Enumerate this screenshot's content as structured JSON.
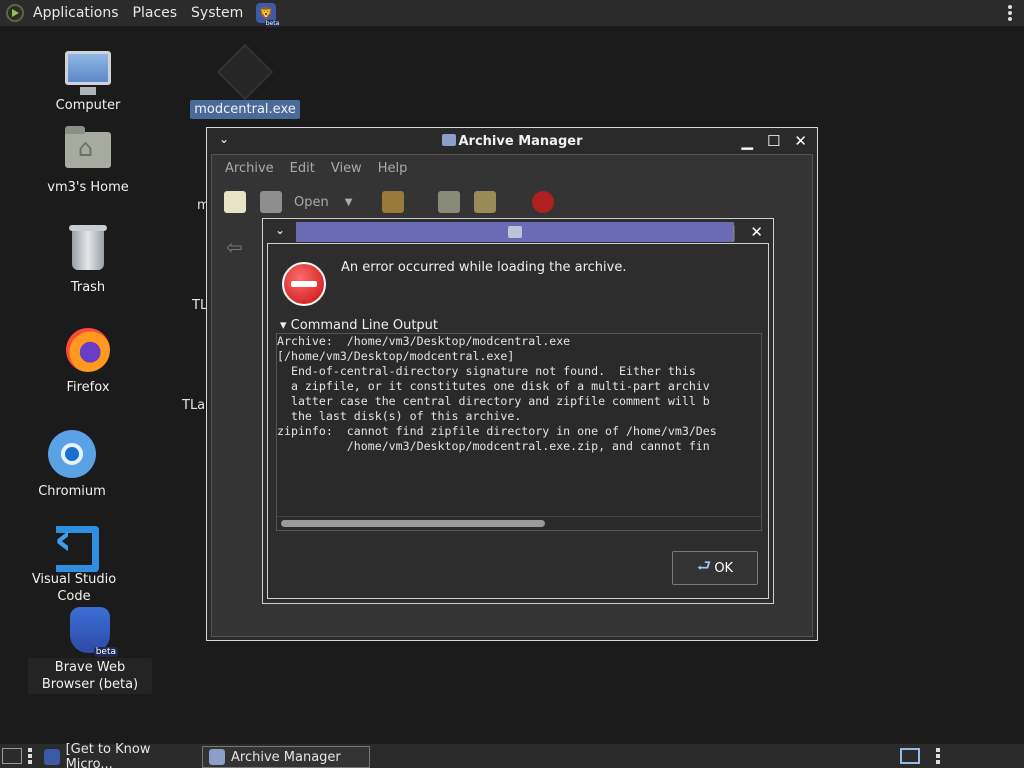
{
  "top_panel": {
    "menus": [
      "Applications",
      "Places",
      "System"
    ]
  },
  "desktop": {
    "icons": [
      {
        "label": "Computer",
        "icon": "computer-icon"
      },
      {
        "label": "vm3's Home",
        "icon": "home-folder-icon"
      },
      {
        "label": "Trash",
        "icon": "trash-icon"
      },
      {
        "label": "Firefox",
        "icon": "firefox-icon"
      },
      {
        "label": "Chromium",
        "icon": "chromium-icon"
      },
      {
        "label": "Visual Studio Code",
        "icon": "vscode-icon"
      },
      {
        "label": "Brave Web Browser (beta)",
        "icon": "brave-icon"
      }
    ],
    "file_icon": {
      "label": "modcentral.exe",
      "icon": "file-icon"
    },
    "partial_labels": [
      "m",
      "TL",
      "TLa"
    ]
  },
  "archive_window": {
    "title": "Archive Manager",
    "menu": [
      "Archive",
      "Edit",
      "View",
      "Help"
    ],
    "toolbar": {
      "open_label": "Open"
    }
  },
  "error_dialog": {
    "message": "An error occurred while loading the archive.",
    "expander_label": "Command Line Output",
    "output": "Archive:  /home/vm3/Desktop/modcentral.exe\n[/home/vm3/Desktop/modcentral.exe]\n  End-of-central-directory signature not found.  Either this\n  a zipfile, or it constitutes one disk of a multi-part archiv\n  latter case the central directory and zipfile comment will b\n  the last disk(s) of this archive.\nzipinfo:  cannot find zipfile directory in one of /home/vm3/Des\n          /home/vm3/Desktop/modcentral.exe.zip, and cannot fin",
    "ok_label": "OK"
  },
  "taskbar": {
    "tasks": [
      {
        "label": "[Get to Know Micro...",
        "active": false
      },
      {
        "label": "Archive Manager",
        "active": true
      }
    ]
  }
}
